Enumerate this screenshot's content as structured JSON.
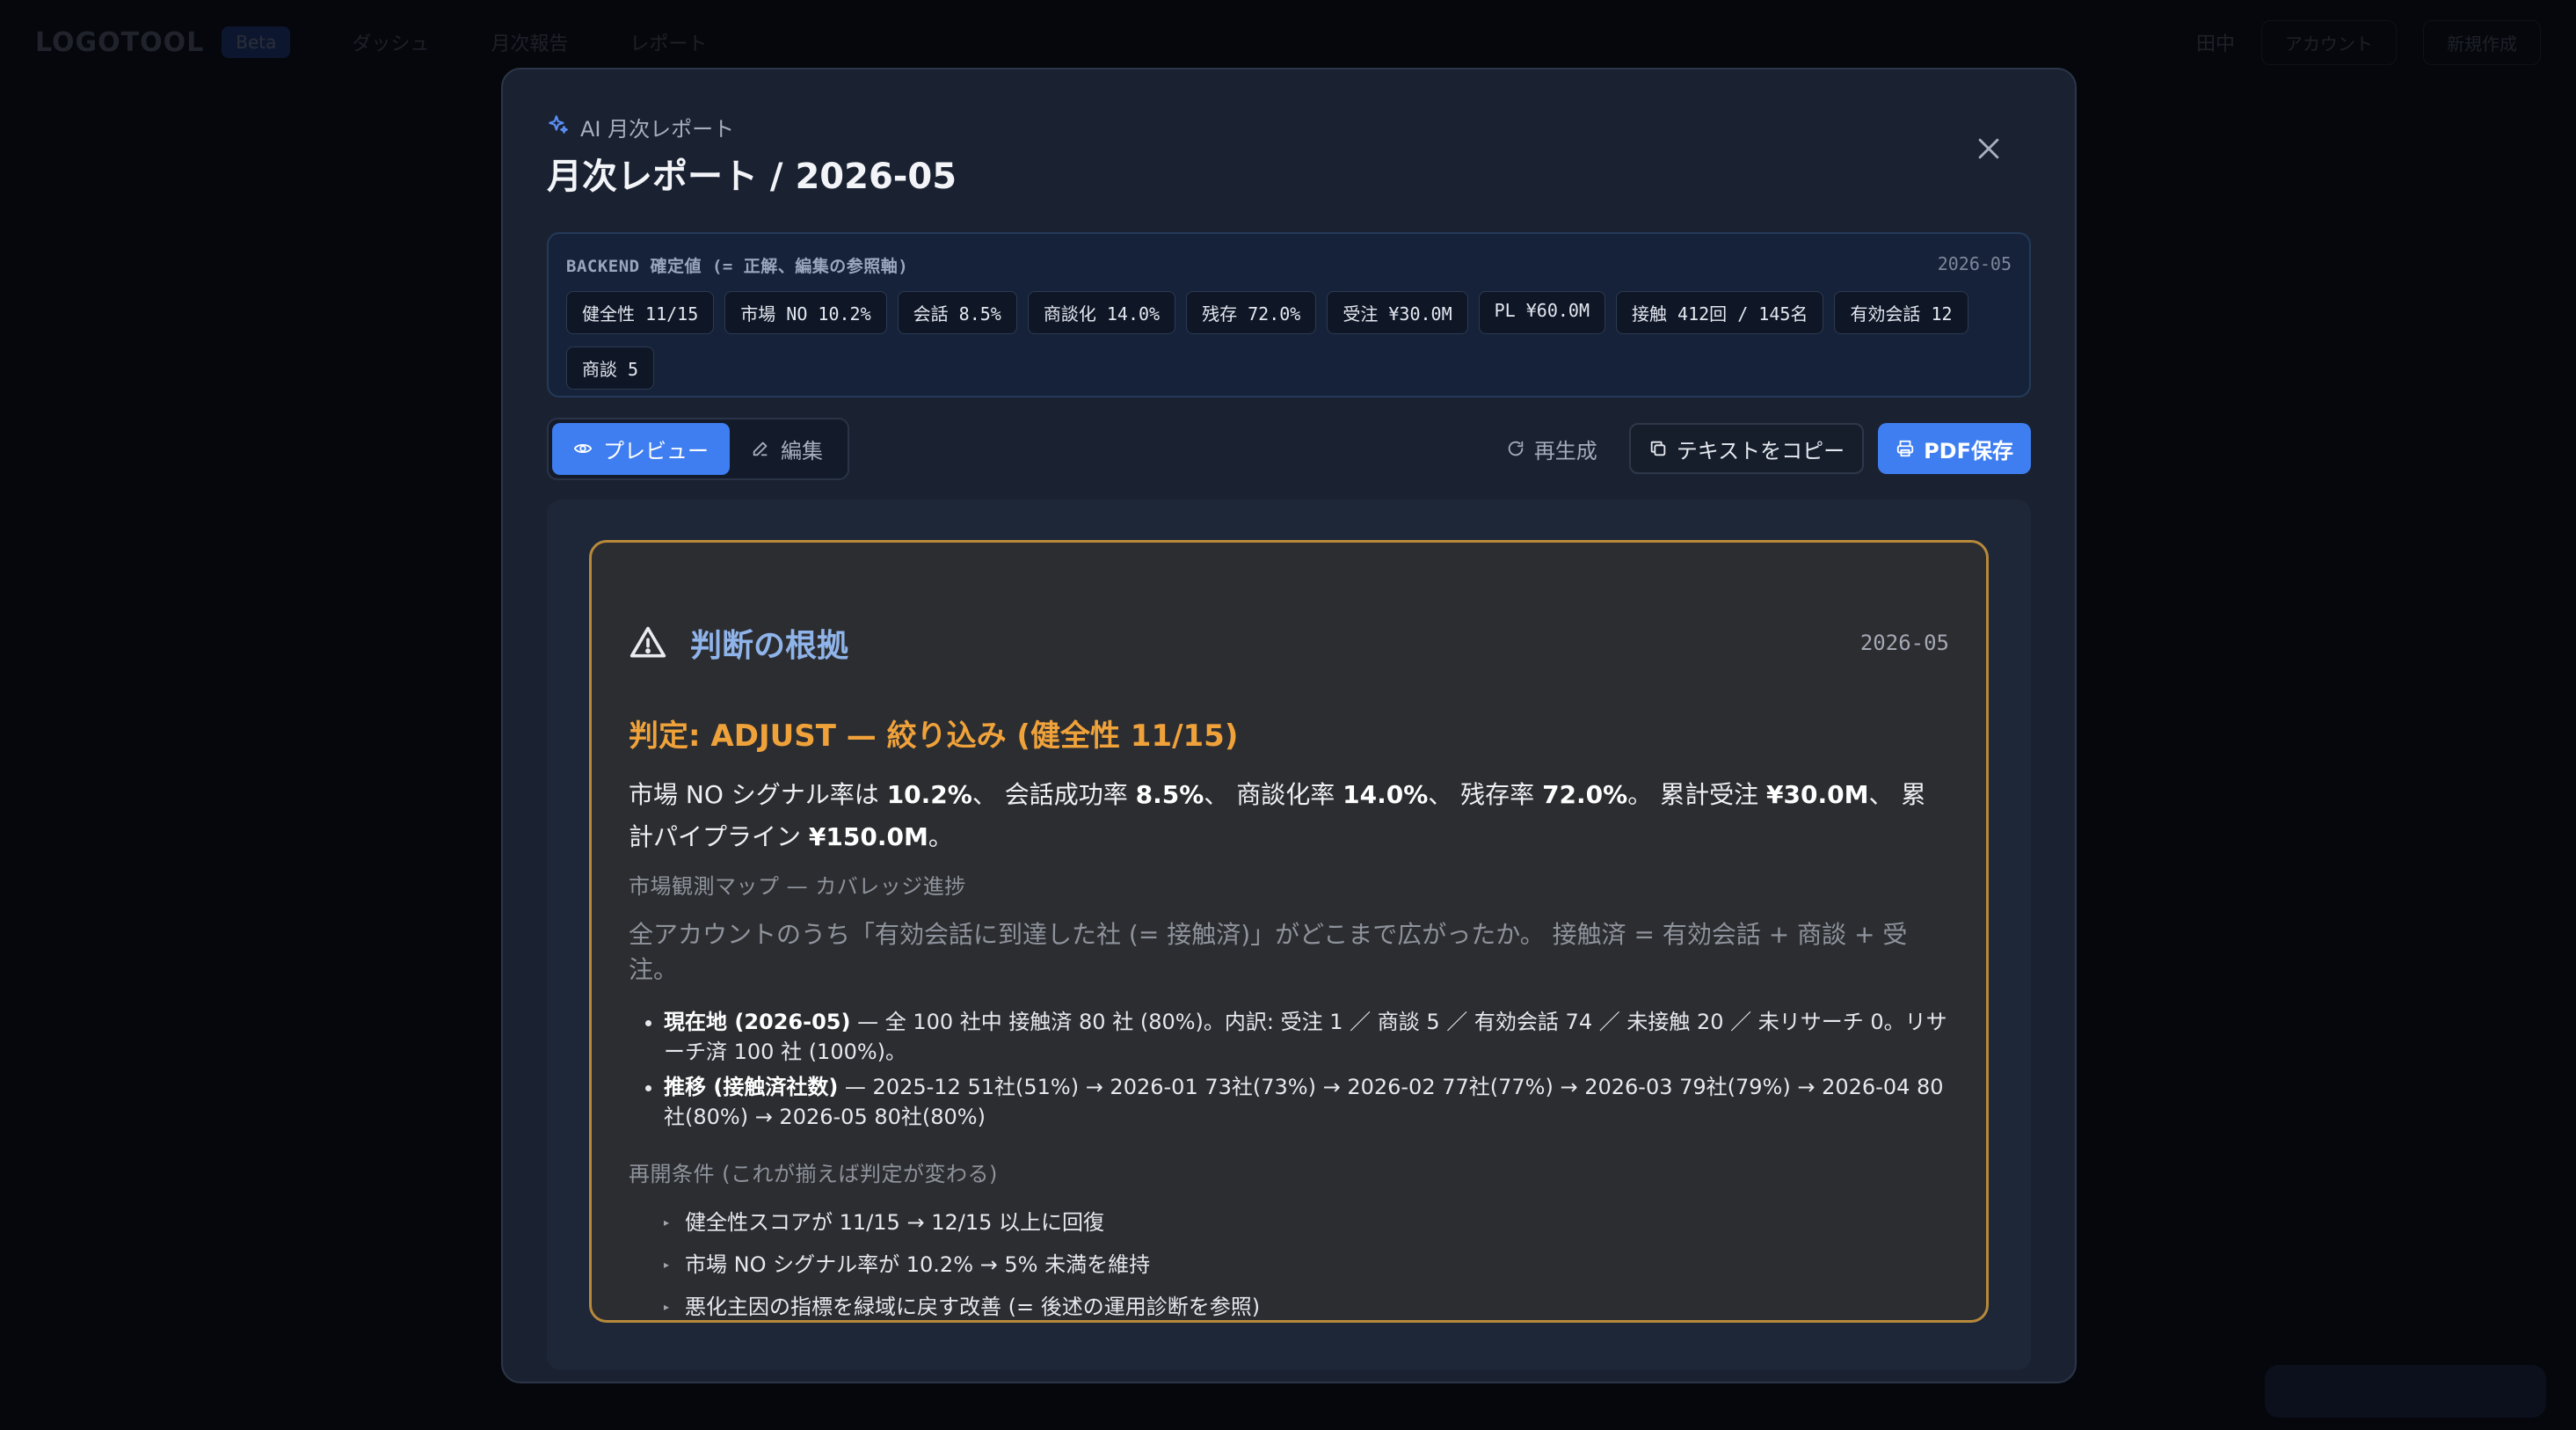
{
  "background": {
    "logo": "LOGOTOOL",
    "badge": "Beta",
    "nav": [
      "ダッシュ",
      "月次報告",
      "レポート"
    ],
    "right_user": "田中",
    "right_pill": "アカウント",
    "right_action": "新規作成"
  },
  "modal": {
    "kicker": "AI 月次レポート",
    "title": "月次レポート / 2026-05",
    "backend": {
      "label": "BACKEND 確定値 (= 正解、編集の参照軸)",
      "date": "2026-05",
      "chips": [
        "健全性 11/15",
        "市場 NO 10.2%",
        "会話 8.5%",
        "商談化 14.0%",
        "残存 72.0%",
        "受注 ¥30.0M",
        "PL ¥60.0M",
        "接触 412回 / 145名",
        "有効会話 12",
        "商談 5"
      ]
    },
    "toolbar": {
      "preview": "プレビュー",
      "edit": "編集",
      "regenerate": "再生成",
      "copy_text": "テキストをコピー",
      "save_pdf": "PDF保存"
    },
    "card": {
      "title": "判断の根拠",
      "date": "2026-05",
      "verdict": "判定: ADJUST — 絞り込み (健全性 11/15)",
      "summary": {
        "t1": "市場 NO シグナル率は ",
        "v1": "10.2%",
        "t2": "、 会話成功率 ",
        "v2": "8.5%",
        "t3": "、 商談化率 ",
        "v3": "14.0%",
        "t4": "、 残存率 ",
        "v4": "72.0%",
        "t5": "。 累計受注 ",
        "v5": "¥30.0M",
        "t6": "、 累計パイプライン ",
        "v6": "¥150.0M",
        "t7": "。"
      },
      "map_label": "市場観測マップ — カバレッジ進捗",
      "map_desc": "全アカウントのうち「有効会話に到達した社 (= 接触済)」がどこまで広がったか。 接触済 = 有効会話 + 商談 + 受注。",
      "bullets": [
        {
          "head": "現在地 (2026-05)",
          "body": " — 全 100 社中 接触済 80 社 (80%)。内訳: 受注 1 ／ 商談 5 ／ 有効会話 74 ／ 未接触 20 ／ 未リサーチ 0。リサーチ済 100 社 (100%)。"
        },
        {
          "head": "推移 (接触済社数)",
          "body": " — 2025-12 51社(51%) → 2026-01 73社(73%) → 2026-02 77社(77%) → 2026-03 79社(79%) → 2026-04 80社(80%) → 2026-05 80社(80%)"
        }
      ],
      "reopen_label": "再開条件 (これが揃えば判定が変わる)",
      "conditions": [
        "健全性スコアが 11/15 → 12/15 以上に回復",
        "市場 NO シグナル率が 10.2% → 5% 未満を維持",
        "悪化主因の指標を緑域に戻す改善 (= 後述の運用診断を参照)"
      ]
    }
  }
}
